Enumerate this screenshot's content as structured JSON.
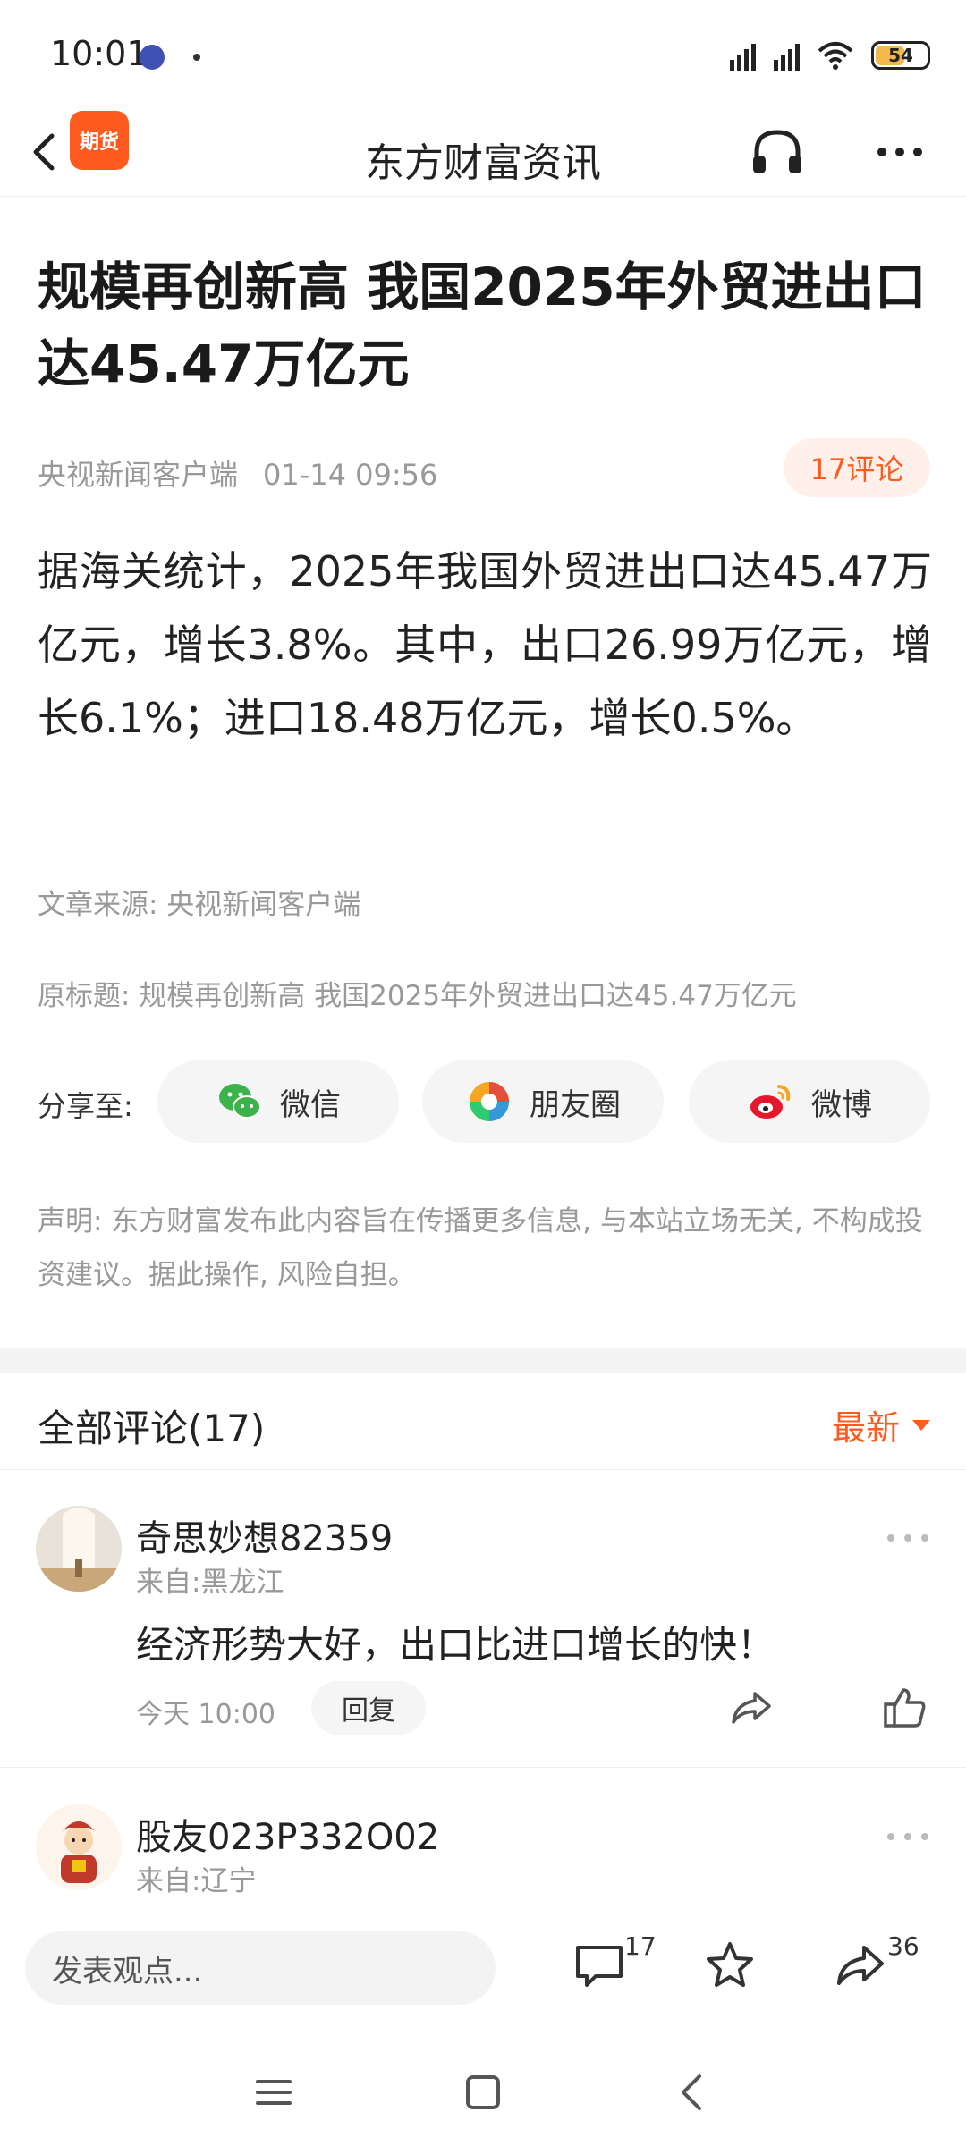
{
  "status_bar": {
    "time": "10:01",
    "battery": "54"
  },
  "nav": {
    "logo_text": "期货",
    "title": "东方财富资讯"
  },
  "article": {
    "title": "规模再创新高 我国2025年外贸进出口达45.47万亿元",
    "source_name": "央视新闻客户端",
    "datetime": "01-14 09:56",
    "comment_pill": "17评论",
    "body": "据海关统计，2025年我国外贸进出口达45.47万亿元，增长3.8%。其中，出口26.99万亿元，增长6.1%；进口18.48万亿元，增长0.5%。",
    "source_line": "文章来源: 央视新闻客户端",
    "original_title_line": "原标题: 规模再创新高 我国2025年外贸进出口达45.47万亿元",
    "share": {
      "label": "分享至:",
      "wechat": "微信",
      "moments": "朋友圈",
      "weibo": "微博"
    },
    "disclaimer": "声明: 东方财富发布此内容旨在传播更多信息, 与本站立场无关, 不构成投资建议。据此操作, 风险自担。"
  },
  "comments": {
    "header": "全部评论(17)",
    "sort": "最新",
    "items": [
      {
        "user": "奇思妙想82359",
        "location": "来自:黑龙江",
        "text": "经济形势大好，出口比进口增长的快！",
        "time": "今天 10:00",
        "reply": "回复"
      },
      {
        "user": "股友023P332O02",
        "location": "来自:辽宁"
      }
    ]
  },
  "action_bar": {
    "placeholder": "发表观点...",
    "comment_count": "17",
    "share_count": "36"
  },
  "icons": {
    "accent": "#ff5a1f"
  }
}
